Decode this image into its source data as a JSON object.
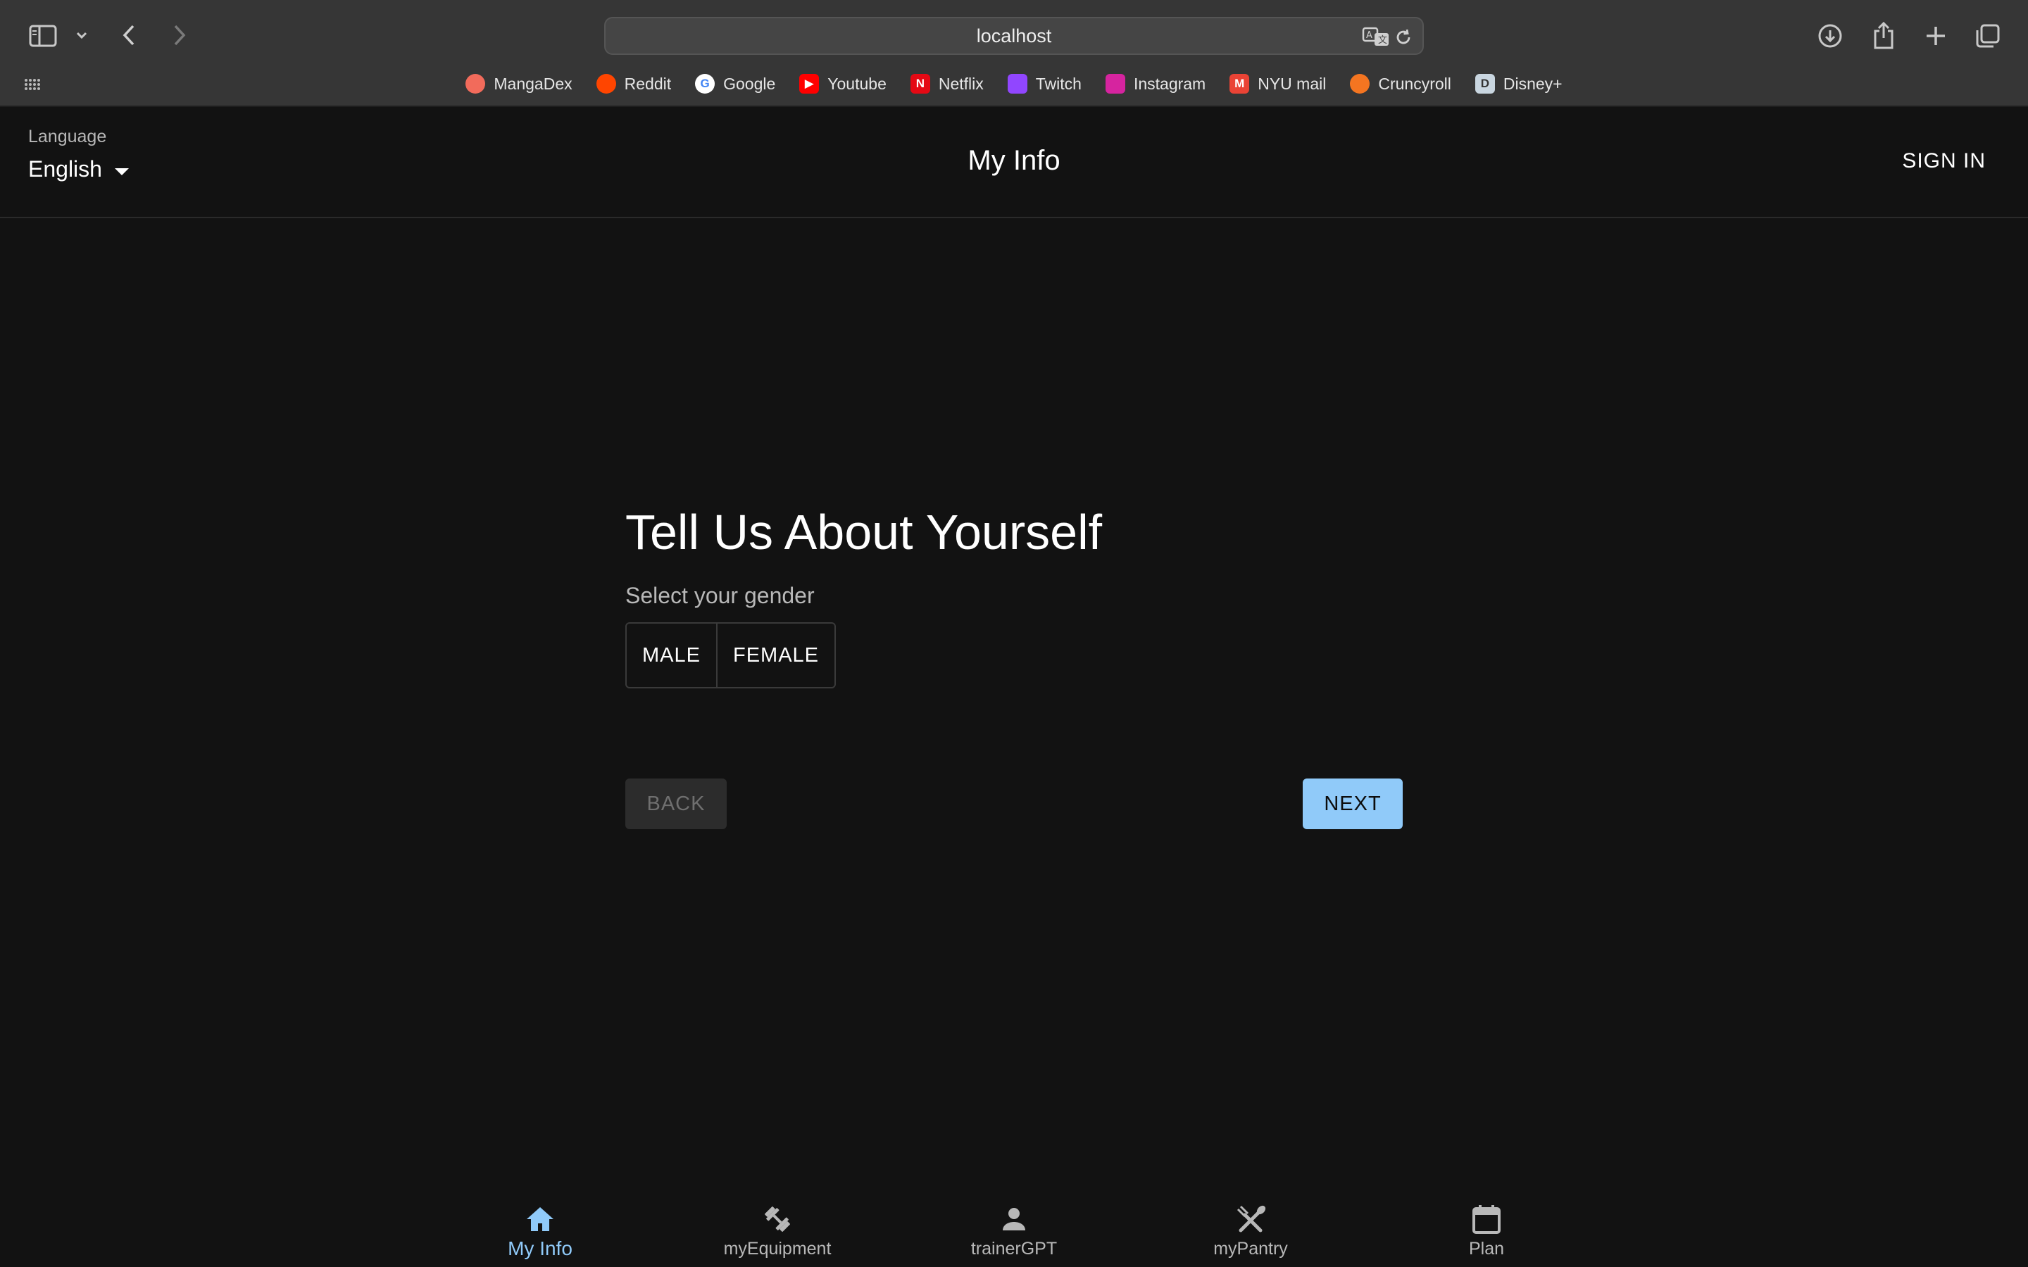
{
  "browser": {
    "address": "localhost",
    "bookmarks": [
      {
        "label": "MangaDex",
        "icon": "mangadex-icon",
        "color": "#f26b5b",
        "glyph": ""
      },
      {
        "label": "Reddit",
        "icon": "reddit-icon",
        "color": "#ff4500",
        "glyph": ""
      },
      {
        "label": "Google",
        "icon": "google-icon",
        "color": "#ffffff",
        "glyph": "G"
      },
      {
        "label": "Youtube",
        "icon": "youtube-icon",
        "color": "#ff0000",
        "glyph": "▶"
      },
      {
        "label": "Netflix",
        "icon": "netflix-icon",
        "color": "#e50914",
        "glyph": "N"
      },
      {
        "label": "Twitch",
        "icon": "twitch-icon",
        "color": "#9146ff",
        "glyph": ""
      },
      {
        "label": "Instagram",
        "icon": "instagram-icon",
        "color": "#d6249f",
        "glyph": ""
      },
      {
        "label": "NYU mail",
        "icon": "gmail-icon",
        "color": "#ea4335",
        "glyph": "M"
      },
      {
        "label": "Cruncyroll",
        "icon": "crunchyroll-icon",
        "color": "#f47521",
        "glyph": ""
      },
      {
        "label": "Disney+",
        "icon": "disney-icon",
        "color": "#c9d6e0",
        "glyph": "D"
      }
    ]
  },
  "header": {
    "language_label": "Language",
    "language_value": "English",
    "title": "My Info",
    "sign_in": "SIGN IN"
  },
  "form": {
    "heading": "Tell Us About Yourself",
    "subheading": "Select your gender",
    "options": [
      "MALE",
      "FEMALE"
    ],
    "back": "BACK",
    "next": "NEXT"
  },
  "nav": {
    "active_color": "#90caf9",
    "items": [
      {
        "label": "My Info",
        "icon": "home-icon",
        "active": true
      },
      {
        "label": "myEquipment",
        "icon": "dumbbell-icon",
        "active": false
      },
      {
        "label": "trainerGPT",
        "icon": "person-icon",
        "active": false
      },
      {
        "label": "myPantry",
        "icon": "utensils-icon",
        "active": false
      },
      {
        "label": "Plan",
        "icon": "calendar-icon",
        "active": false
      }
    ]
  }
}
